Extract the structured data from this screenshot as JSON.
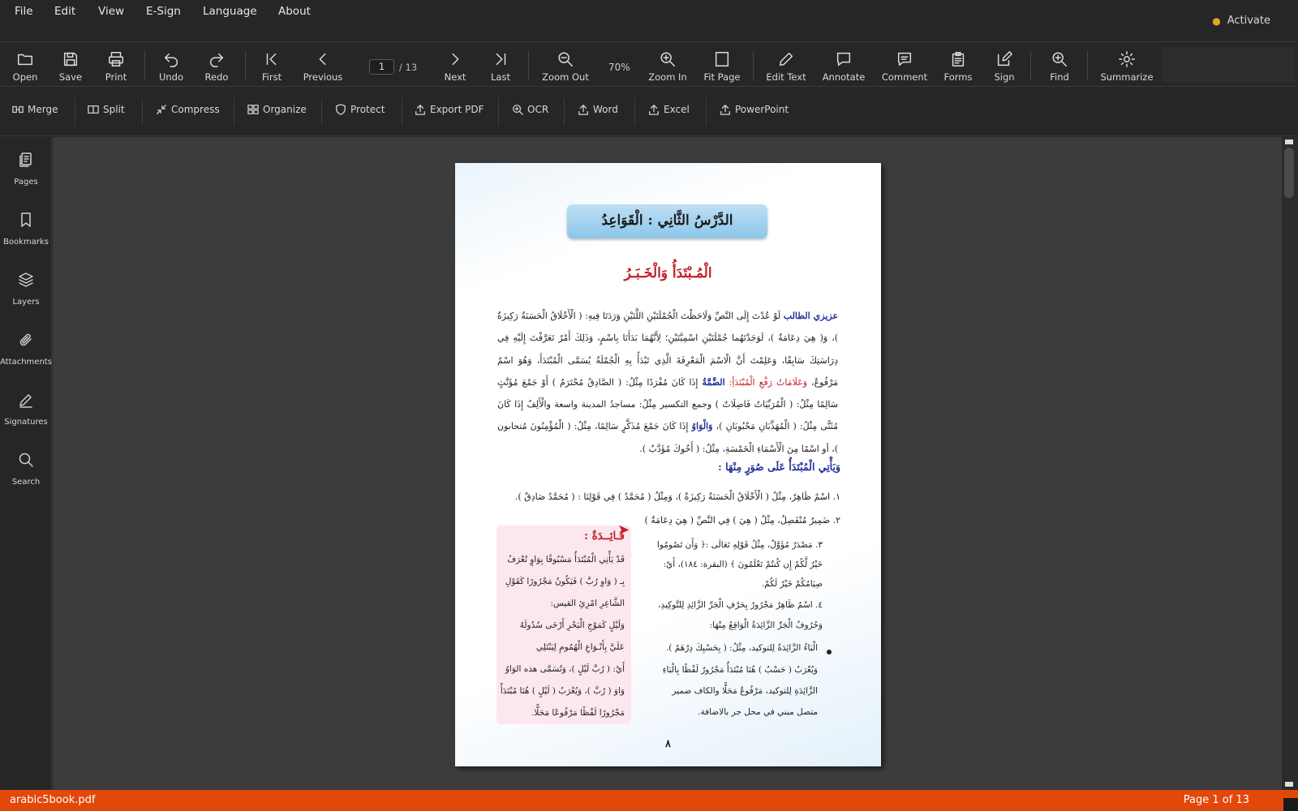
{
  "menu": {
    "items": [
      "File",
      "Edit",
      "View",
      "E-Sign",
      "Language",
      "About"
    ],
    "activate": "Activate"
  },
  "toolbar": {
    "open": "Open",
    "save": "Save",
    "print": "Print",
    "undo": "Undo",
    "redo": "Redo",
    "first": "First",
    "previous": "Previous",
    "page_current": "1",
    "page_total": "/ 13",
    "next": "Next",
    "last": "Last",
    "zoom_out": "Zoom Out",
    "zoom_value": "70%",
    "zoom_in": "Zoom In",
    "fit_page": "Fit Page",
    "edit_text": "Edit Text",
    "annotate": "Annotate",
    "comment": "Comment",
    "forms": "Forms",
    "sign": "Sign",
    "find": "Find",
    "summarize": "Summarize"
  },
  "tools": {
    "merge": "Merge",
    "split": "Split",
    "compress": "Compress",
    "organize": "Organize",
    "protect": "Protect",
    "export_pdf": "Export PDF",
    "ocr": "OCR",
    "word": "Word",
    "excel": "Excel",
    "powerpoint": "PowerPoint"
  },
  "sidebar": {
    "pages": "Pages",
    "bookmarks": "Bookmarks",
    "layers": "Layers",
    "attachments": "Attachments",
    "signatures": "Signatures",
    "search": "Search"
  },
  "document": {
    "title": "الدَّرْسُ الثَّانِي : الْقَوَاعِدُ",
    "section_title": "الْمُـبْتَدَأُ وَالْخَـبَـرُ",
    "intro_highlight": "عزيزي الطالب",
    "intro_text": "لَوْ عُدْتَ إِلَى النَّصِّ وَلَاحَظْتَ الْجُمْلَتَيْنِ اللَّتَيْنِ وَرَدَتَا فِيهِ: ( الْأَخْلَاقُ الْحَسَنَةُ رَكِيزَةٌ )، وَ( هِيَ دِعَامَةٌ )، لَوَجَدْتَهُما جُمْلَتَيْنِ اسْمِيَّتَيْنِ؛ لِأَنَّهُمَا بَدَأَتَا بِاسْمٍ، وَذَلِكَ أَمْرٌ تَعَرَّفْتَ إِلَيْهِ فِي دِرَاسَتِكَ سَابِقًا، وَعَلِمْتَ أَنَّ الْاسْمَ الْمَعْرِفَةَ الَّذِي تَبْدَأُ بِهِ الْجُمْلَةُ يُسَمَّى الْمُبْتَدَأَ، وَهُوَ اسْمٌ مَرْفُوعٌ،",
    "intro_red": "وَعَلَامَاتُ رَفْعِ الْمُبْتَدَأِ:",
    "intro_blue1": "الضَّمَّةُ",
    "intro_text2": "إِذَا كَانَ مُفْرَدًا مِثْلُ: ( الصَّادِقُ مُحْتَرَمٌ ) أَوْ جَمْعَ مُؤَنَّثٍ سَالِمًا مِثْلُ: ( الْمُرَبِّيَاتُ فَاضِلَاتٌ ) وجمع التكسير مِثْلُ: مساجدُ المدينة واسعة والْأَلِفُ إِذَا كَانَ مُثَنًّى مِثْلُ: ( الْمُهَذَّبَانِ مَحْبُوبَانِ )،",
    "intro_blue2": "وَالْوَاوُ",
    "intro_text3": "إِذَا كَانَ جَمْعَ مُذَكَّرٍ سَالِمًا، مِثْلُ: ( الْمُؤْمِنُونَ مُتحابون )، أو اسْمًا مِنَ الْأَسْمَاءِ الْخَمْسَةِ، مِثْلُ: ( أَخُوكَ مُؤَدَّبٌ ).",
    "forms_heading": "وَيَأْتِي الْمُبْتَدَأُ عَلَى صُوَرٍ مِنْهَا :",
    "item1": "١. اسْمٌ ظَاهِرٌ، مِثْلُ ( الْأَخْلَاقُ الْحَسَنَةُ رَكِيزَةٌ )، وَمِثْلُ ( مُحَمَّدٌ ) فِي قَوْلِنَا : ( مُحَمَّدٌ صَادِقٌ ).",
    "item2": "٢. ضَمِيرٌ مُنْفَصِلٌ، مِثْلُ ( هِيَ ) فِي النَّصِّ ( هِيَ دِعَامَةٌ )",
    "item3_l1": "٣. مَصْدَرٌ مُؤَوَّلٌ، مِثْلُ قَوْلِهِ تَعَالَى :﴿ وَأَن تَصُومُوا",
    "item3_l2": "خَيْرٌ لَّكُمْ إِن كُنتُمْ تَعْلَمُونَ ﴾ (البقرة: ١٨٤)، أَيْ:",
    "item3_l3": "صِيَامُكُمْ خَيْرٌ لَكُمْ.",
    "item4_l1": "٤. اسْمٌ ظَاهِرٌ مَجْرُورٌ بِحَرْفِ الْجَرِّ الزَّائِدِ لِلتَّوكِيدِ،",
    "item4_l2": "وَحُرُوفُ الْجَرِّ الزَّائِدَةُ الْوَاقِعُ مِنْهَا:",
    "bullet_l1": "الْبَاءُ الزَّائِدَةُ لِلتوكيد، مِثْلُ: ( بِحَسْبِكَ دِرْهَمٌ ).",
    "bullet_l2": "وَيُعْرَبُ ( حَسْبُ ) هُنَا مُبْتَدَأٌ مَجْرُورٌ لَفْظًا بِالْبَاءِ",
    "bullet_l3": "الزَّائِدَةِ لِلتوكيد، مَرْفُوعٌ مَحَلًّا والكاف ضمير",
    "bullet_l4": "متصل مبني في محل جر بالاضافة.",
    "note_title": "فَـائِــدَةٌ :",
    "note_l1": "قَدْ يَأْتِي الْمُبْتَدَأُ مَسْبُوقًا بِوَاوٍ تُعْرَفُ",
    "note_l2": "بِـ ( وَاوِ رُبَّ ) فَيَكُونُ مَجْرُورًا كَقَوْلِ",
    "note_l3": "الشَّاعِرِ امْرِئِ القيس:",
    "note_l4": "وَلَيْلٍ كَمَوْجِ الْبَحْرِ أَرْخَى سُدُولَهُ",
    "note_l5": "عَلَيَّ بِأَنْـوَاعِ الْهُمُومِ لِيَبْتَلِي",
    "note_l6": "أَيْ: ( رُبَّ لَيْلٍ )، وَتُسَمَّى هذه الوَاوُ",
    "note_l7": "وَاوَ ( رُبَّ )، وَيُعْرَبُ ( لَيْلٍ ) هُنَا مُبْتَدَأً",
    "note_l8": "مَجْرُورًا لَفْظًا مَرْفُوعًا مَحَلًّا.",
    "page_number": "٨"
  },
  "status": {
    "filename": "arabic5book.pdf",
    "page_info": "Page 1 of 13"
  },
  "colors": {
    "accent": "#e3480b",
    "heading_red": "#c0202b",
    "heading_blue": "#20309a"
  }
}
